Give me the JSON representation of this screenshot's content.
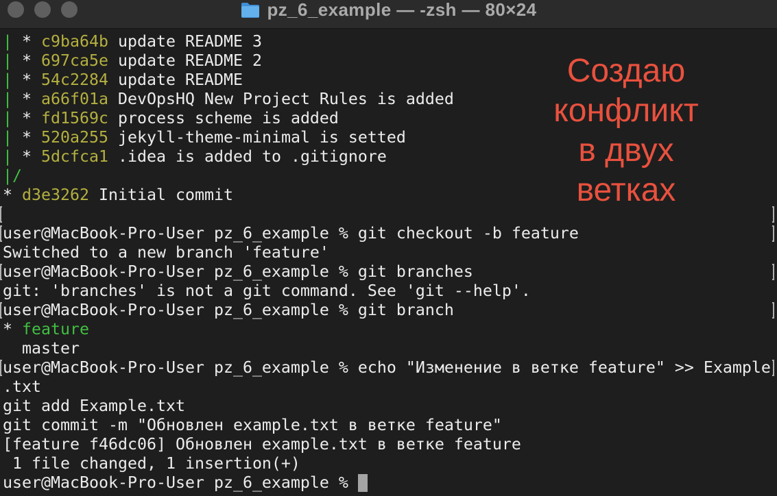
{
  "window": {
    "title": "pz_6_example — -zsh — 80×24",
    "icon": "folder-icon"
  },
  "ui": {
    "titlebar_bg": "#2b2b2b",
    "terminal_bg": "#1e1e1e",
    "title_text": "#aaaaaa",
    "traffic_light": "#5f5f5f",
    "cursor": "#a4a4a4",
    "mark": "#b0b0b0",
    "annotation": "#e9513e"
  },
  "colors": {
    "text": "#ececec",
    "graph": "#41bf41",
    "hash": "#b4b040",
    "branch": "#41bf41"
  },
  "terminal": {
    "lines": [
      {
        "segments": [
          {
            "text": "|",
            "role": "graph"
          },
          {
            "text": " * ",
            "role": "node"
          },
          {
            "text": "c9ba64b",
            "role": "hash"
          },
          {
            "text": " update README 3",
            "role": "text"
          }
        ]
      },
      {
        "segments": [
          {
            "text": "|",
            "role": "graph"
          },
          {
            "text": " * ",
            "role": "node"
          },
          {
            "text": "697ca5e",
            "role": "hash"
          },
          {
            "text": " update README 2",
            "role": "text"
          }
        ]
      },
      {
        "segments": [
          {
            "text": "|",
            "role": "graph"
          },
          {
            "text": " * ",
            "role": "node"
          },
          {
            "text": "54c2284",
            "role": "hash"
          },
          {
            "text": " update README",
            "role": "text"
          }
        ]
      },
      {
        "segments": [
          {
            "text": "|",
            "role": "graph"
          },
          {
            "text": " * ",
            "role": "node"
          },
          {
            "text": "a66f01a",
            "role": "hash"
          },
          {
            "text": " DevOpsHQ New Project Rules is added",
            "role": "text"
          }
        ]
      },
      {
        "segments": [
          {
            "text": "|",
            "role": "graph"
          },
          {
            "text": " * ",
            "role": "node"
          },
          {
            "text": "fd1569c",
            "role": "hash"
          },
          {
            "text": " process scheme is added",
            "role": "text"
          }
        ]
      },
      {
        "segments": [
          {
            "text": "|",
            "role": "graph"
          },
          {
            "text": " * ",
            "role": "node"
          },
          {
            "text": "520a255",
            "role": "hash"
          },
          {
            "text": " jekyll-theme-minimal is setted",
            "role": "text"
          }
        ]
      },
      {
        "segments": [
          {
            "text": "|",
            "role": "graph"
          },
          {
            "text": " * ",
            "role": "node"
          },
          {
            "text": "5dcfca1",
            "role": "hash"
          },
          {
            "text": " .idea is added to .gitignore",
            "role": "text"
          }
        ]
      },
      {
        "segments": [
          {
            "text": "|/",
            "role": "graph"
          }
        ]
      },
      {
        "segments": [
          {
            "text": "* ",
            "role": "node"
          },
          {
            "text": "d3e3262",
            "role": "hash"
          },
          {
            "text": " Initial commit",
            "role": "text"
          }
        ]
      },
      {
        "marked": true,
        "segments": []
      },
      {
        "marked": true,
        "segments": [
          {
            "text": "user@MacBook-Pro-User pz_6_example % ",
            "role": "prompt"
          },
          {
            "text": "git checkout -b feature",
            "role": "command"
          }
        ]
      },
      {
        "segments": [
          {
            "text": "Switched to a new branch 'feature'",
            "role": "text"
          }
        ]
      },
      {
        "marked": true,
        "segments": [
          {
            "text": "user@MacBook-Pro-User pz_6_example % ",
            "role": "prompt"
          },
          {
            "text": "git branches",
            "role": "command"
          }
        ]
      },
      {
        "segments": [
          {
            "text": "git: 'branches' is not a git command. See 'git --help'.",
            "role": "text"
          }
        ]
      },
      {
        "marked": true,
        "segments": [
          {
            "text": "user@MacBook-Pro-User pz_6_example % ",
            "role": "prompt"
          },
          {
            "text": "git branch",
            "role": "command"
          }
        ]
      },
      {
        "segments": [
          {
            "text": "* ",
            "role": "marker"
          },
          {
            "text": "feature",
            "role": "branch"
          }
        ]
      },
      {
        "segments": [
          {
            "text": "  master",
            "role": "text"
          }
        ]
      },
      {
        "marked": true,
        "segments": [
          {
            "text": "user@MacBook-Pro-User pz_6_example % ",
            "role": "prompt"
          },
          {
            "text": "echo \"Изменение в ветке feature\" >> Example",
            "role": "command"
          }
        ]
      },
      {
        "segments": [
          {
            "text": ".txt",
            "role": "command"
          }
        ]
      },
      {
        "segments": [
          {
            "text": "git add Example.txt",
            "role": "command"
          }
        ]
      },
      {
        "segments": [
          {
            "text": "git commit -m \"Обновлен example.txt в ветке feature\"",
            "role": "command"
          }
        ]
      },
      {
        "segments": [
          {
            "text": "[feature f46dc06] Обновлен example.txt в ветке feature",
            "role": "text"
          }
        ]
      },
      {
        "segments": [
          {
            "text": " 1 file changed, 1 insertion(+)",
            "role": "text"
          }
        ]
      },
      {
        "cursor": true,
        "segments": [
          {
            "text": "user@MacBook-Pro-User pz_6_example % ",
            "role": "prompt"
          }
        ]
      }
    ]
  },
  "annotation": {
    "lines": [
      "Создаю",
      "конфликт",
      "в двух",
      "ветках"
    ]
  }
}
